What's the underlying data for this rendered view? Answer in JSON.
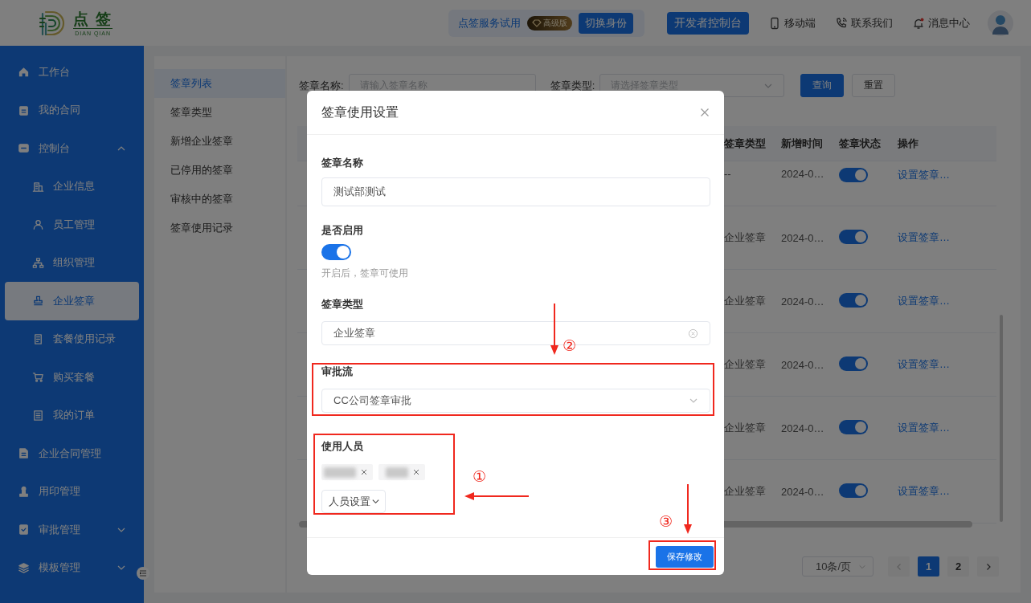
{
  "header": {
    "logo": {
      "title": "点 签",
      "subtitle": "DIAN QIAN"
    },
    "trial": {
      "label": "点签服务试用",
      "badge": "高级版",
      "button": "切换身份"
    },
    "developer_button": "开发者控制台",
    "links": [
      {
        "kind": "mobile",
        "label": "移动端"
      },
      {
        "kind": "contact",
        "label": "联系我们"
      },
      {
        "kind": "messages",
        "label": "消息中心",
        "unread": true
      }
    ]
  },
  "sidebar": {
    "items": [
      {
        "label": "工作台",
        "selected": false
      },
      {
        "label": "我的合同",
        "selected": false
      },
      {
        "label": "控制台",
        "selected": false,
        "expanded": true,
        "children": [
          {
            "label": "企业信息",
            "selected": false
          },
          {
            "label": "员工管理",
            "selected": false
          },
          {
            "label": "组织管理",
            "selected": false
          },
          {
            "label": "企业签章",
            "selected": true
          },
          {
            "label": "套餐使用记录",
            "selected": false
          },
          {
            "label": "购买套餐",
            "selected": false
          },
          {
            "label": "我的订单",
            "selected": false
          }
        ]
      },
      {
        "label": "企业合同管理",
        "selected": false
      },
      {
        "label": "用印管理",
        "selected": false
      },
      {
        "label": "审批管理",
        "selected": false,
        "expanded": false
      },
      {
        "label": "模板管理",
        "selected": false,
        "expanded": false
      }
    ]
  },
  "submenu": [
    {
      "label": "签章列表",
      "selected": true
    },
    {
      "label": "签章类型",
      "selected": false
    },
    {
      "label": "新增企业签章",
      "selected": false
    },
    {
      "label": "已停用的签章",
      "selected": false
    },
    {
      "label": "审核中的签章",
      "selected": false
    },
    {
      "label": "签章使用记录",
      "selected": false
    }
  ],
  "filters": [
    {
      "kind": "input",
      "label": "签章名称:",
      "placeholder": "请输入签章名称"
    },
    {
      "kind": "select",
      "label": "签章类型:",
      "placeholder": "请选择签章类型"
    }
  ],
  "filter_buttons": [
    {
      "kind": "primary",
      "label": "查询"
    },
    {
      "kind": "default",
      "label": "重置"
    }
  ],
  "table": {
    "columns": [
      "签章类型",
      "新增时间",
      "签章状态",
      "操作"
    ],
    "rows": [
      {
        "type": "--",
        "time": "2024-0…",
        "enabled": true,
        "action": "设置签章…"
      },
      {
        "type": "企业签章",
        "time": "2024-0…",
        "enabled": true,
        "action": "设置签章…"
      },
      {
        "type": "企业签章",
        "time": "2024-0…",
        "enabled": true,
        "action": "设置签章…"
      },
      {
        "type": "企业签章",
        "time": "2024-0…",
        "enabled": true,
        "action": "设置签章…"
      },
      {
        "type": "企业签章",
        "time": "2024-0…",
        "enabled": true,
        "action": "设置签章…"
      },
      {
        "type": "企业签章",
        "time": "2024-0…",
        "enabled": true,
        "action": "设置签章…"
      }
    ]
  },
  "pagination": {
    "page_size": "10条/页",
    "pages": [
      {
        "label": "1",
        "selected": true
      },
      {
        "label": "2",
        "selected": false
      }
    ]
  },
  "dialog": {
    "title": "签章使用设置",
    "fields": [
      {
        "kind": "input",
        "label": "签章名称",
        "value": "测试部测试",
        "highlighted": false
      },
      {
        "kind": "switch",
        "label": "是否启用",
        "on": true,
        "hint": "开启后，签章可使用",
        "highlighted": false
      },
      {
        "kind": "select",
        "label": "签章类型",
        "value": "企业签章",
        "clearable": true,
        "highlighted": false
      },
      {
        "kind": "select",
        "label": "审批流",
        "value": "CC公司签章审批",
        "clearable": false,
        "highlighted": true
      },
      {
        "kind": "users",
        "label": "使用人员",
        "tags": [
          {
            "kind": "blurred"
          },
          {
            "kind": "blurred"
          }
        ],
        "button": "人员设置",
        "highlighted": true
      }
    ],
    "save": {
      "label": "保存修改",
      "highlighted": true
    },
    "annotations": [
      {
        "label": "②"
      },
      {
        "label": "①"
      },
      {
        "label": "③"
      }
    ]
  }
}
